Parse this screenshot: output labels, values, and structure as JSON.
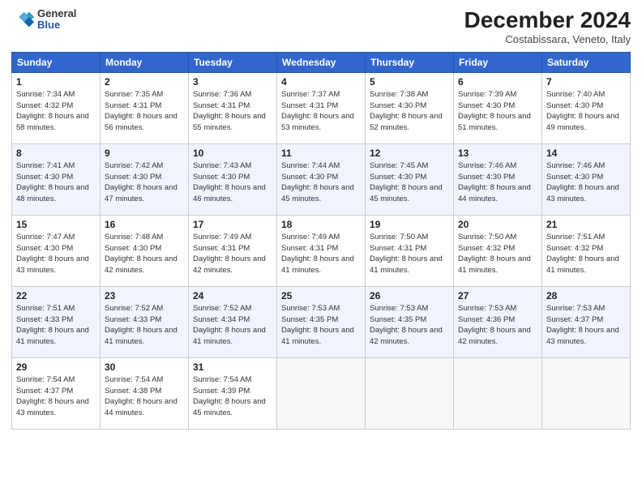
{
  "header": {
    "logo_general": "General",
    "logo_blue": "Blue",
    "title": "December 2024",
    "location": "Costabissara, Veneto, Italy"
  },
  "weekdays": [
    "Sunday",
    "Monday",
    "Tuesday",
    "Wednesday",
    "Thursday",
    "Friday",
    "Saturday"
  ],
  "weeks": [
    [
      {
        "day": "1",
        "sunrise": "Sunrise: 7:34 AM",
        "sunset": "Sunset: 4:32 PM",
        "daylight": "Daylight: 8 hours and 58 minutes."
      },
      {
        "day": "2",
        "sunrise": "Sunrise: 7:35 AM",
        "sunset": "Sunset: 4:31 PM",
        "daylight": "Daylight: 8 hours and 56 minutes."
      },
      {
        "day": "3",
        "sunrise": "Sunrise: 7:36 AM",
        "sunset": "Sunset: 4:31 PM",
        "daylight": "Daylight: 8 hours and 55 minutes."
      },
      {
        "day": "4",
        "sunrise": "Sunrise: 7:37 AM",
        "sunset": "Sunset: 4:31 PM",
        "daylight": "Daylight: 8 hours and 53 minutes."
      },
      {
        "day": "5",
        "sunrise": "Sunrise: 7:38 AM",
        "sunset": "Sunset: 4:30 PM",
        "daylight": "Daylight: 8 hours and 52 minutes."
      },
      {
        "day": "6",
        "sunrise": "Sunrise: 7:39 AM",
        "sunset": "Sunset: 4:30 PM",
        "daylight": "Daylight: 8 hours and 51 minutes."
      },
      {
        "day": "7",
        "sunrise": "Sunrise: 7:40 AM",
        "sunset": "Sunset: 4:30 PM",
        "daylight": "Daylight: 8 hours and 49 minutes."
      }
    ],
    [
      {
        "day": "8",
        "sunrise": "Sunrise: 7:41 AM",
        "sunset": "Sunset: 4:30 PM",
        "daylight": "Daylight: 8 hours and 48 minutes."
      },
      {
        "day": "9",
        "sunrise": "Sunrise: 7:42 AM",
        "sunset": "Sunset: 4:30 PM",
        "daylight": "Daylight: 8 hours and 47 minutes."
      },
      {
        "day": "10",
        "sunrise": "Sunrise: 7:43 AM",
        "sunset": "Sunset: 4:30 PM",
        "daylight": "Daylight: 8 hours and 46 minutes."
      },
      {
        "day": "11",
        "sunrise": "Sunrise: 7:44 AM",
        "sunset": "Sunset: 4:30 PM",
        "daylight": "Daylight: 8 hours and 45 minutes."
      },
      {
        "day": "12",
        "sunrise": "Sunrise: 7:45 AM",
        "sunset": "Sunset: 4:30 PM",
        "daylight": "Daylight: 8 hours and 45 minutes."
      },
      {
        "day": "13",
        "sunrise": "Sunrise: 7:46 AM",
        "sunset": "Sunset: 4:30 PM",
        "daylight": "Daylight: 8 hours and 44 minutes."
      },
      {
        "day": "14",
        "sunrise": "Sunrise: 7:46 AM",
        "sunset": "Sunset: 4:30 PM",
        "daylight": "Daylight: 8 hours and 43 minutes."
      }
    ],
    [
      {
        "day": "15",
        "sunrise": "Sunrise: 7:47 AM",
        "sunset": "Sunset: 4:30 PM",
        "daylight": "Daylight: 8 hours and 43 minutes."
      },
      {
        "day": "16",
        "sunrise": "Sunrise: 7:48 AM",
        "sunset": "Sunset: 4:30 PM",
        "daylight": "Daylight: 8 hours and 42 minutes."
      },
      {
        "day": "17",
        "sunrise": "Sunrise: 7:49 AM",
        "sunset": "Sunset: 4:31 PM",
        "daylight": "Daylight: 8 hours and 42 minutes."
      },
      {
        "day": "18",
        "sunrise": "Sunrise: 7:49 AM",
        "sunset": "Sunset: 4:31 PM",
        "daylight": "Daylight: 8 hours and 41 minutes."
      },
      {
        "day": "19",
        "sunrise": "Sunrise: 7:50 AM",
        "sunset": "Sunset: 4:31 PM",
        "daylight": "Daylight: 8 hours and 41 minutes."
      },
      {
        "day": "20",
        "sunrise": "Sunrise: 7:50 AM",
        "sunset": "Sunset: 4:32 PM",
        "daylight": "Daylight: 8 hours and 41 minutes."
      },
      {
        "day": "21",
        "sunrise": "Sunrise: 7:51 AM",
        "sunset": "Sunset: 4:32 PM",
        "daylight": "Daylight: 8 hours and 41 minutes."
      }
    ],
    [
      {
        "day": "22",
        "sunrise": "Sunrise: 7:51 AM",
        "sunset": "Sunset: 4:33 PM",
        "daylight": "Daylight: 8 hours and 41 minutes."
      },
      {
        "day": "23",
        "sunrise": "Sunrise: 7:52 AM",
        "sunset": "Sunset: 4:33 PM",
        "daylight": "Daylight: 8 hours and 41 minutes."
      },
      {
        "day": "24",
        "sunrise": "Sunrise: 7:52 AM",
        "sunset": "Sunset: 4:34 PM",
        "daylight": "Daylight: 8 hours and 41 minutes."
      },
      {
        "day": "25",
        "sunrise": "Sunrise: 7:53 AM",
        "sunset": "Sunset: 4:35 PM",
        "daylight": "Daylight: 8 hours and 41 minutes."
      },
      {
        "day": "26",
        "sunrise": "Sunrise: 7:53 AM",
        "sunset": "Sunset: 4:35 PM",
        "daylight": "Daylight: 8 hours and 42 minutes."
      },
      {
        "day": "27",
        "sunrise": "Sunrise: 7:53 AM",
        "sunset": "Sunset: 4:36 PM",
        "daylight": "Daylight: 8 hours and 42 minutes."
      },
      {
        "day": "28",
        "sunrise": "Sunrise: 7:53 AM",
        "sunset": "Sunset: 4:37 PM",
        "daylight": "Daylight: 8 hours and 43 minutes."
      }
    ],
    [
      {
        "day": "29",
        "sunrise": "Sunrise: 7:54 AM",
        "sunset": "Sunset: 4:37 PM",
        "daylight": "Daylight: 8 hours and 43 minutes."
      },
      {
        "day": "30",
        "sunrise": "Sunrise: 7:54 AM",
        "sunset": "Sunset: 4:38 PM",
        "daylight": "Daylight: 8 hours and 44 minutes."
      },
      {
        "day": "31",
        "sunrise": "Sunrise: 7:54 AM",
        "sunset": "Sunset: 4:39 PM",
        "daylight": "Daylight: 8 hours and 45 minutes."
      },
      null,
      null,
      null,
      null
    ]
  ]
}
